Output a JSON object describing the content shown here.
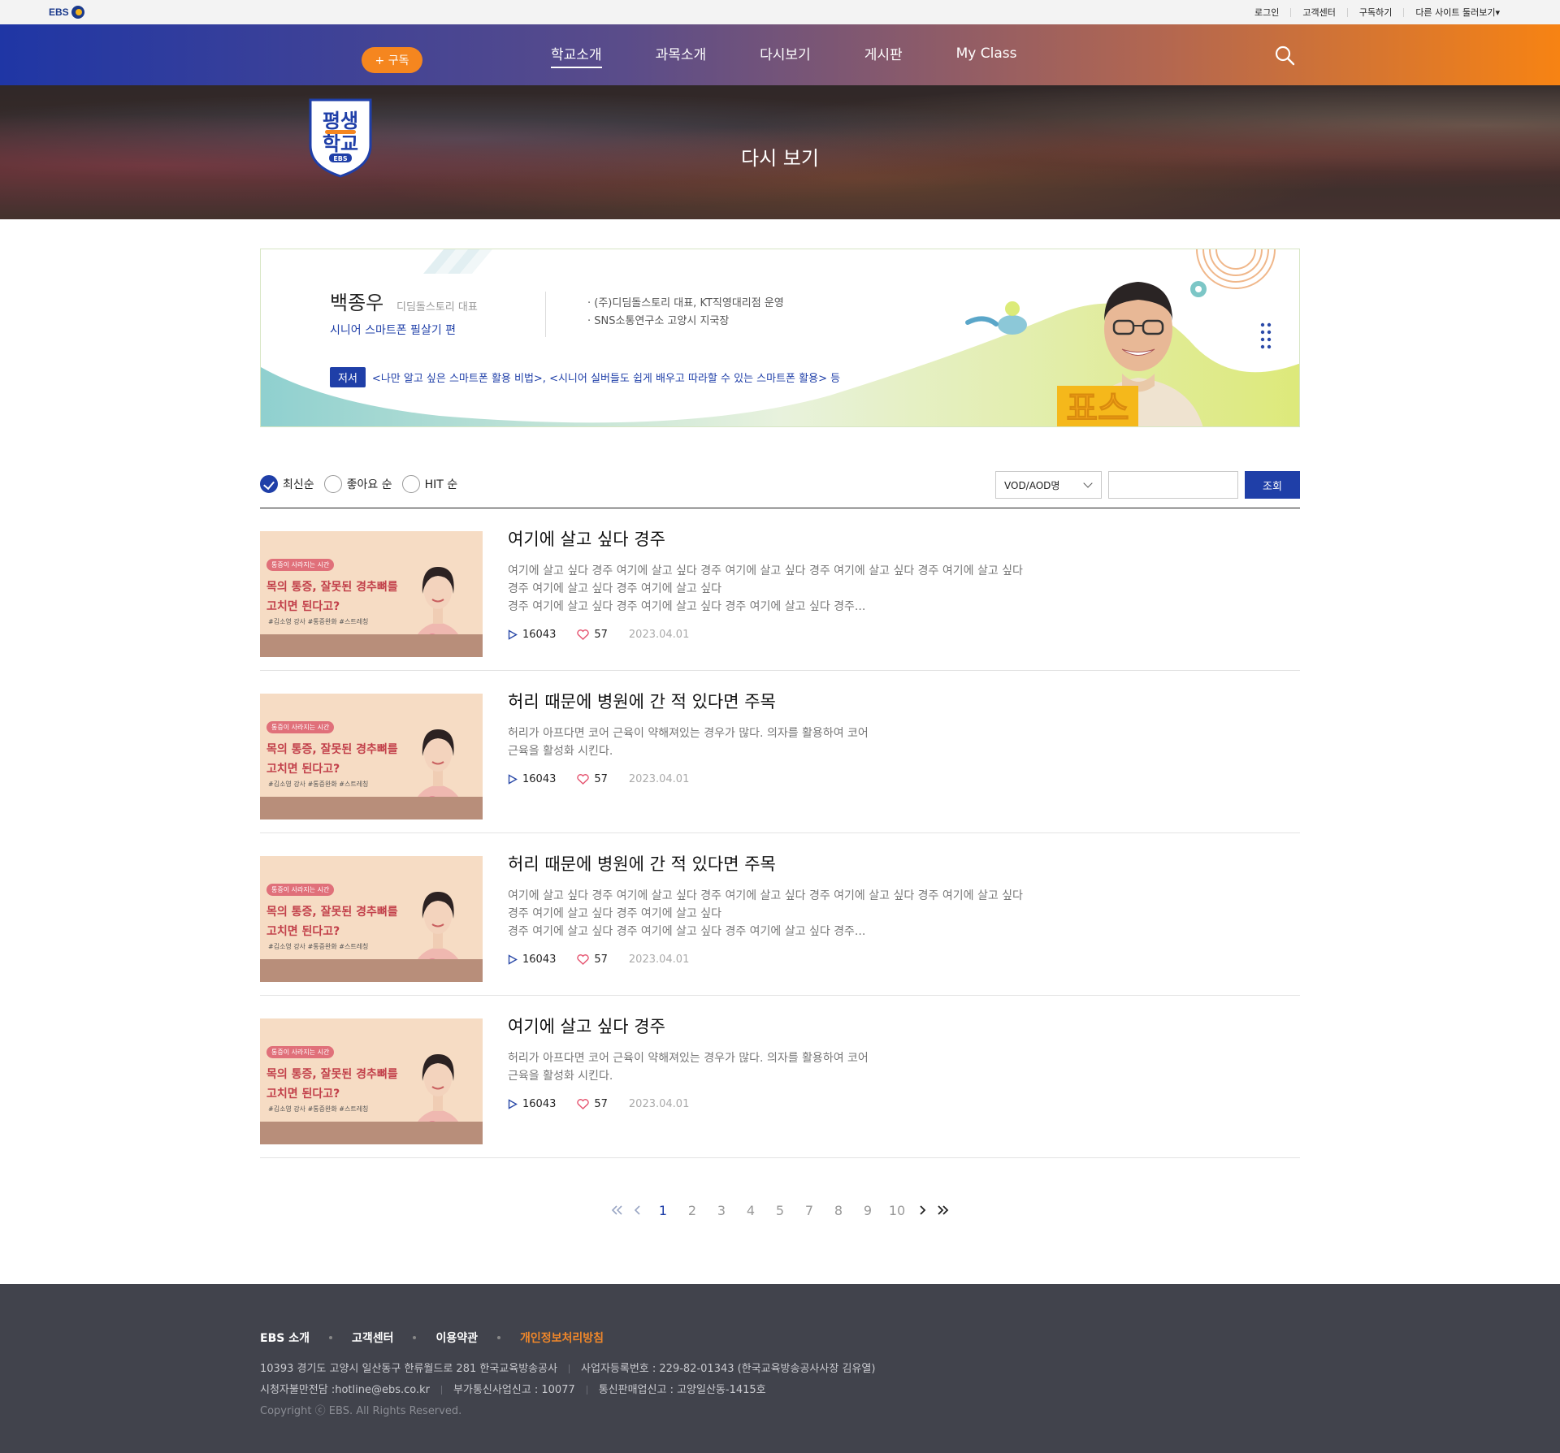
{
  "util": {
    "logo": "EBS",
    "links": [
      "로그인",
      "고객센터",
      "구독하기",
      "다른 사이트 둘러보기▾"
    ]
  },
  "gnb": {
    "subscribe_label": "+ 구독",
    "menu": [
      "학교소개",
      "과목소개",
      "다시보기",
      "게시판",
      "My Class"
    ],
    "active": "다시보기"
  },
  "hero": {
    "logo_line1": "평생",
    "logo_line2": "학교",
    "logo_badge": "EBS",
    "title": "다시 보기"
  },
  "teacher": {
    "name": "백종우",
    "role": "디딤돌스토리 대표",
    "course": "시니어 스마트폰 필살기 편",
    "career": [
      "· (주)디딤돌스토리 대표, KT직영대리점 운영",
      "· SNS소통연구소 고양시 지국장"
    ],
    "books_tag": "저서",
    "books": "<나만 알고 싶은 스마트폰 활용 비법>, <시니어 실버들도 쉽게 배우고 따라할 수 있는 스마트폰 활용> 등",
    "sign_text": "표스"
  },
  "filter": {
    "sorts": [
      "최신순",
      "좋아요 순",
      "HIT 순"
    ],
    "selected": 0,
    "select_value": "VOD/AOD명",
    "search_placeholder": "",
    "search_button": "조회"
  },
  "thumb": {
    "badge": "통증이 사라지는 시간",
    "line1": "목의 통증, 잘못된 경추뼈를",
    "line2": "고치면 된다고?",
    "tags": "#김소영 강사  #통증완화  #스트레칭"
  },
  "items": [
    {
      "title": "여기에 살고 싶다 경주",
      "desc": [
        "여기에 살고 싶다 경주 여기에 살고 싶다 경주 여기에 살고 싶다 경주 여기에 살고 싶다 경주 여기에 살고 싶다",
        "경주 여기에 살고 싶다 경주 여기에 살고 싶다",
        "경주 여기에 살고 싶다 경주 여기에 살고 싶다 경주 여기에 살고 싶다 경주..."
      ],
      "views": "16043",
      "likes": "57",
      "date": "2023.04.01"
    },
    {
      "title": "허리 때문에 병원에 간 적 있다면 주목",
      "desc": [
        "허리가 아프다면 코어 근육이 약해져있는 경우가 많다. 의자를 활용하여 코어",
        "근육을 활성화 시킨다."
      ],
      "views": "16043",
      "likes": "57",
      "date": "2023.04.01"
    },
    {
      "title": "허리 때문에 병원에 간 적 있다면 주목",
      "desc": [
        "여기에 살고 싶다 경주 여기에 살고 싶다 경주 여기에 살고 싶다 경주 여기에 살고 싶다 경주 여기에 살고 싶다",
        "경주 여기에 살고 싶다 경주 여기에 살고 싶다",
        "경주 여기에 살고 싶다 경주 여기에 살고 싶다 경주 여기에 살고 싶다 경주..."
      ],
      "views": "16043",
      "likes": "57",
      "date": "2023.04.01"
    },
    {
      "title": "여기에 살고 싶다 경주",
      "desc": [
        "허리가 아프다면 코어 근육이 약해져있는 경우가 많다. 의자를 활용하여 코어",
        "근육을 활성화 시킨다."
      ],
      "views": "16043",
      "likes": "57",
      "date": "2023.04.01"
    }
  ],
  "pager": {
    "pages": [
      "1",
      "2",
      "3",
      "4",
      "5",
      "7",
      "8",
      "9",
      "10"
    ],
    "current": "1"
  },
  "footer": {
    "links": [
      "EBS 소개",
      "고객센터",
      "이용약관",
      "개인정보처리방침"
    ],
    "address": "10393 경기도 고양시 일산동구 한류월드로 281 한국교육방송공사",
    "biz": "사업자등록번호 : 229-82-01343 (한국교육방송공사사장 김유열)",
    "hotline": "시청자불만전담 :hotline@ebs.co.kr",
    "vas": "부가통신사업신고 : 10077",
    "mail_order": "통신판매업신고 : 고양일산동-1415호",
    "copyright": "Copyright ⓒ EBS. All Rights Reserved."
  },
  "colors": {
    "brand_blue": "#1f3fa8",
    "brand_orange": "#f5861f",
    "footer_bg": "#41434c"
  }
}
